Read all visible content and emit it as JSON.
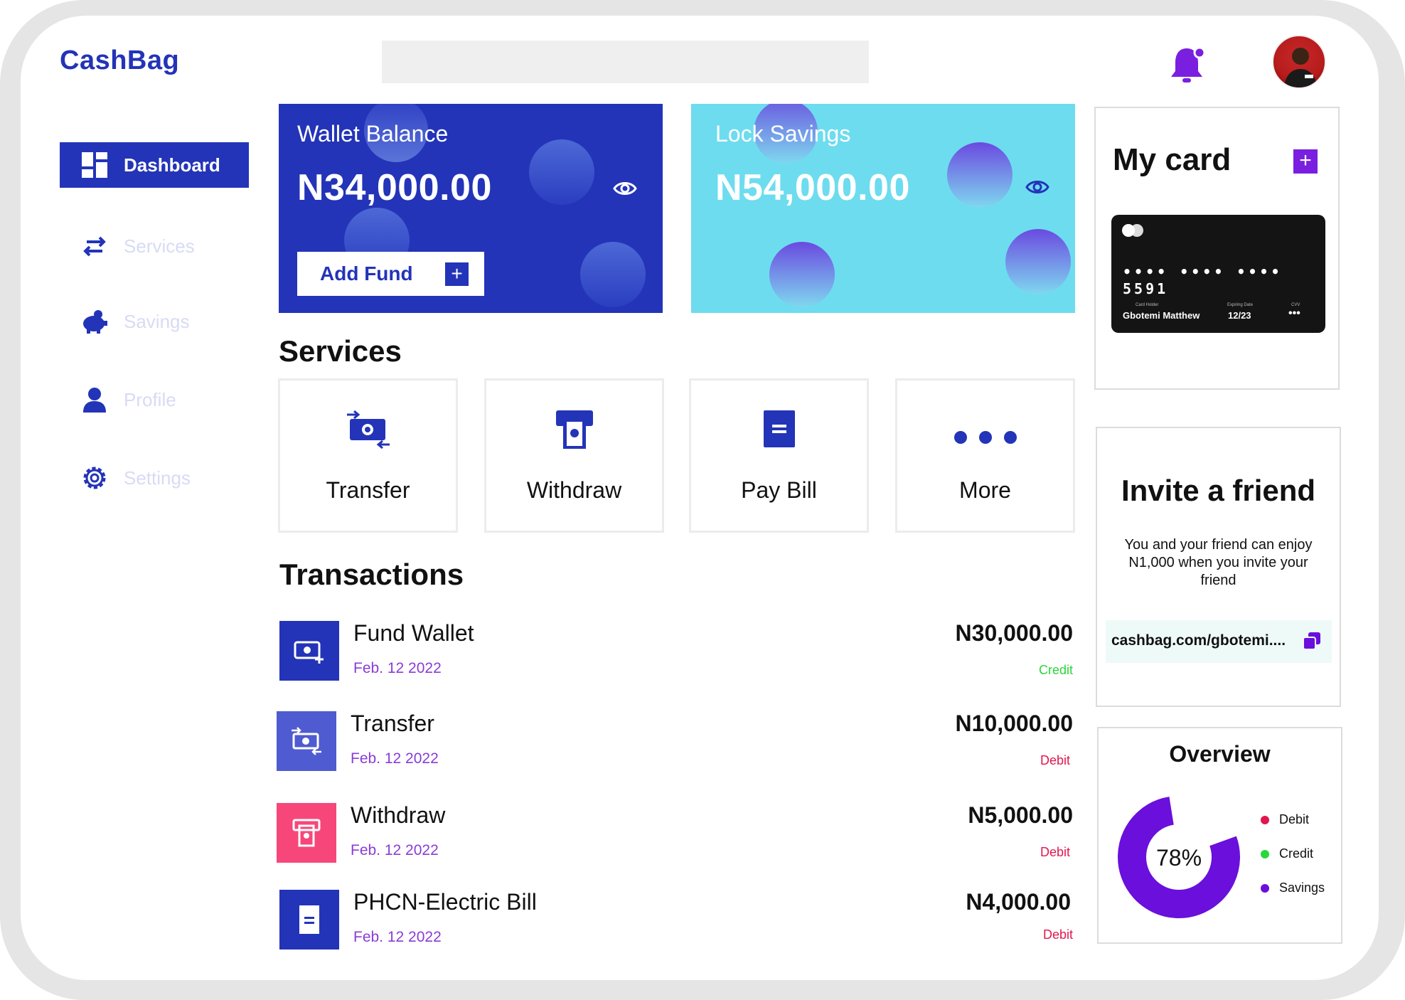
{
  "app": {
    "logo": "CashBag"
  },
  "header": {
    "search_placeholder": "",
    "notifications_icon": "bell-icon",
    "avatar": "user-avatar"
  },
  "sidebar": {
    "items": [
      {
        "label": "Dashboard",
        "icon": "dashboard-icon",
        "active": true
      },
      {
        "label": "Services",
        "icon": "transfer-arrows-icon",
        "active": false
      },
      {
        "label": "Savings",
        "icon": "piggy-bank-icon",
        "active": false
      },
      {
        "label": "Profile",
        "icon": "user-icon",
        "active": false
      },
      {
        "label": "Settings",
        "icon": "gear-icon",
        "active": false
      }
    ]
  },
  "wallet": {
    "title": "Wallet Balance",
    "amount": "N34,000.00",
    "add_fund_label": "Add Fund",
    "color": "#2334b8"
  },
  "lock_savings": {
    "title": "Lock Savings",
    "amount": "N54,000.00",
    "color": "#6ddcef"
  },
  "services": {
    "heading": "Services",
    "tiles": [
      {
        "label": "Transfer",
        "icon": "money-transfer-icon"
      },
      {
        "label": "Withdraw",
        "icon": "atm-withdraw-icon"
      },
      {
        "label": "Pay Bill",
        "icon": "bill-icon"
      },
      {
        "label": "More",
        "icon": "more-dots-icon"
      }
    ]
  },
  "transactions": {
    "heading": "Transactions",
    "rows": [
      {
        "name": "Fund Wallet",
        "date": "Feb. 12 2022",
        "amount": "N30,000.00",
        "type": "Credit",
        "type_color": "#29d63b",
        "icon_bg": "#2334b8",
        "icon": "fund-wallet-icon"
      },
      {
        "name": "Transfer",
        "date": "Feb. 12 2022",
        "amount": "N10,000.00",
        "type": "Debit",
        "type_color": "#e0174f",
        "icon_bg": "#4f5bd0",
        "icon": "money-transfer-icon"
      },
      {
        "name": "Withdraw",
        "date": "Feb. 12 2022",
        "amount": "N5,000.00",
        "type": "Debit",
        "type_color": "#e0174f",
        "icon_bg": "#f7477a",
        "icon": "atm-withdraw-icon"
      },
      {
        "name": "PHCN-Electric Bill",
        "date": "Feb. 12 2022",
        "amount": "N4,000.00",
        "type": "Debit",
        "type_color": "#e0174f",
        "icon_bg": "#2334b8",
        "icon": "bill-icon"
      }
    ]
  },
  "my_card": {
    "title": "My card",
    "masked_number": "•••• •••• •••• 5591",
    "holder_label": "Card Holder",
    "holder_name": "Gbotemi Matthew",
    "expiry_label": "Expiring Date",
    "expiry": "12/23",
    "cvv_label": "CVV",
    "cvv": "•••"
  },
  "invite": {
    "title": "Invite a friend",
    "text": "You and your friend can enjoy N1,000 when you invite your friend",
    "link": "cashbag.com/gbotemi...."
  },
  "overview": {
    "title": "Overview",
    "percent_label": "78%",
    "percent": 78,
    "legend": [
      {
        "label": "Debit",
        "color": "#e0174f"
      },
      {
        "label": "Credit",
        "color": "#29d63b"
      },
      {
        "label": "Savings",
        "color": "#6a0fdc"
      }
    ]
  }
}
